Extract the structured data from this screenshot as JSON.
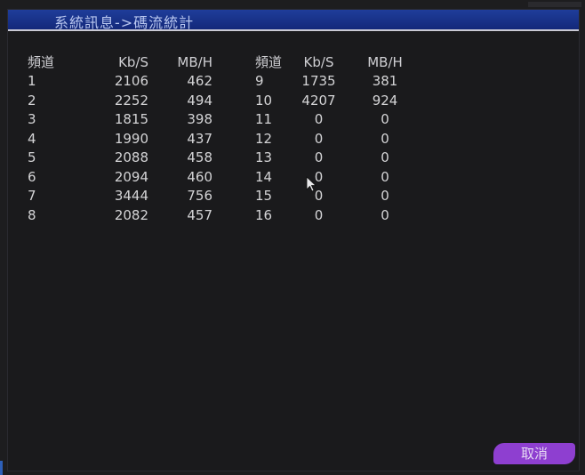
{
  "window": {
    "title": "系統訊息->碼流統計"
  },
  "table": {
    "headers": [
      "頻道",
      "Kb/S",
      "MB/H",
      "頻道",
      "Kb/S",
      "MB/H"
    ],
    "rows": [
      [
        "1",
        "2106",
        "462",
        "9",
        "1735",
        "381"
      ],
      [
        "2",
        "2252",
        "494",
        "10",
        "4207",
        "924"
      ],
      [
        "3",
        "1815",
        "398",
        "11",
        "0",
        "0"
      ],
      [
        "4",
        "1990",
        "437",
        "12",
        "0",
        "0"
      ],
      [
        "5",
        "2088",
        "458",
        "13",
        "0",
        "0"
      ],
      [
        "6",
        "2094",
        "460",
        "14",
        "0",
        "0"
      ],
      [
        "7",
        "3444",
        "756",
        "15",
        "0",
        "0"
      ],
      [
        "8",
        "2082",
        "457",
        "16",
        "0",
        "0"
      ]
    ]
  },
  "buttons": {
    "cancel_label": "取消"
  },
  "colors": {
    "title_bar": "#1f3d9a",
    "cancel_button": "#8e3fd0",
    "background": "#1d1d1f"
  }
}
